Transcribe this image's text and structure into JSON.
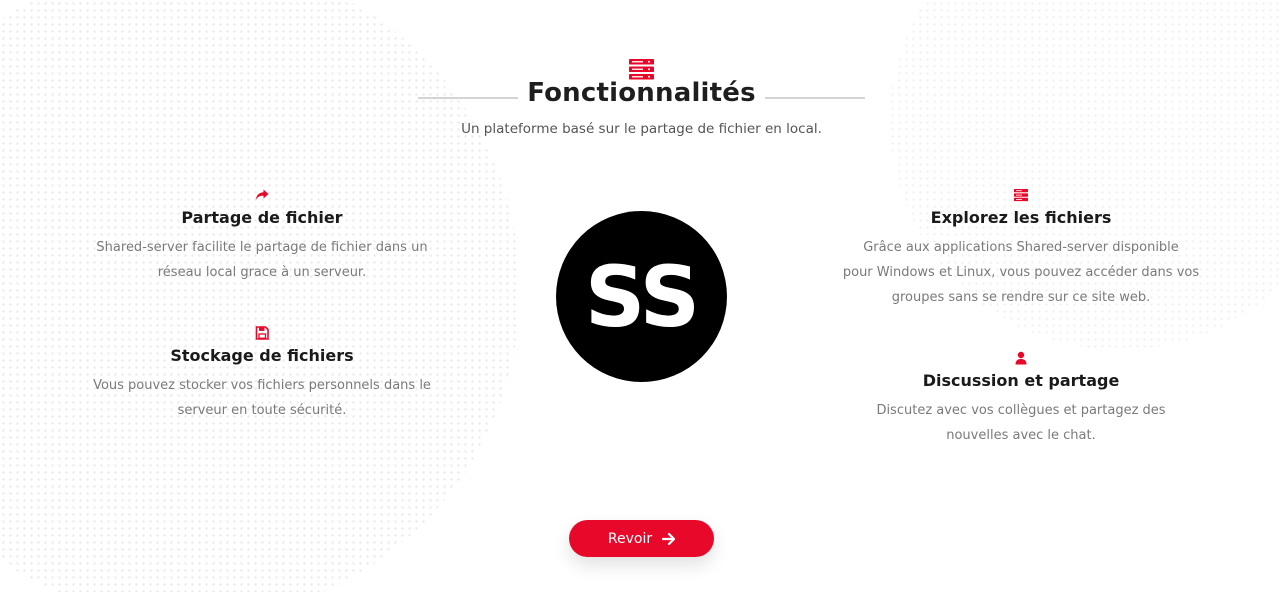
{
  "section": {
    "title": "Fonctionnalités",
    "subtitle": "Un plateforme basé sur le partage de fichier en local.",
    "header_icon": "server-icon"
  },
  "features": [
    {
      "icon": "share-icon",
      "title": "Partage de fichier",
      "line1": "Shared-server facilite le partage de fichier dans un",
      "line2": "réseau local grace à un serveur."
    },
    {
      "icon": "save-icon",
      "title": "Stockage de fichiers",
      "line1": "Vous pouvez stocker vos fichiers personnels dans le",
      "line2": "serveur en toute sécurité."
    },
    {
      "icon": "server-icon",
      "title": "Explorez les fichiers",
      "line1": "Grâce aux applications Shared-server disponible",
      "line2": "pour Windows et Linux, vous pouvez accéder dans vos",
      "line3": "groupes sans se rendre sur ce site web."
    },
    {
      "icon": "user-icon",
      "title": "Discussion et partage",
      "line1": "Discutez avec vos collègues et partagez des",
      "line2": "nouvelles avec le chat."
    }
  ],
  "logo": {
    "text": "SS"
  },
  "button": {
    "label": "Revoir",
    "icon": "arrow-right-icon"
  },
  "colors": {
    "accent": "#e8082a",
    "title": "#1e1e1e",
    "body_text": "#7a7a7a",
    "logo_bg": "#000000"
  }
}
